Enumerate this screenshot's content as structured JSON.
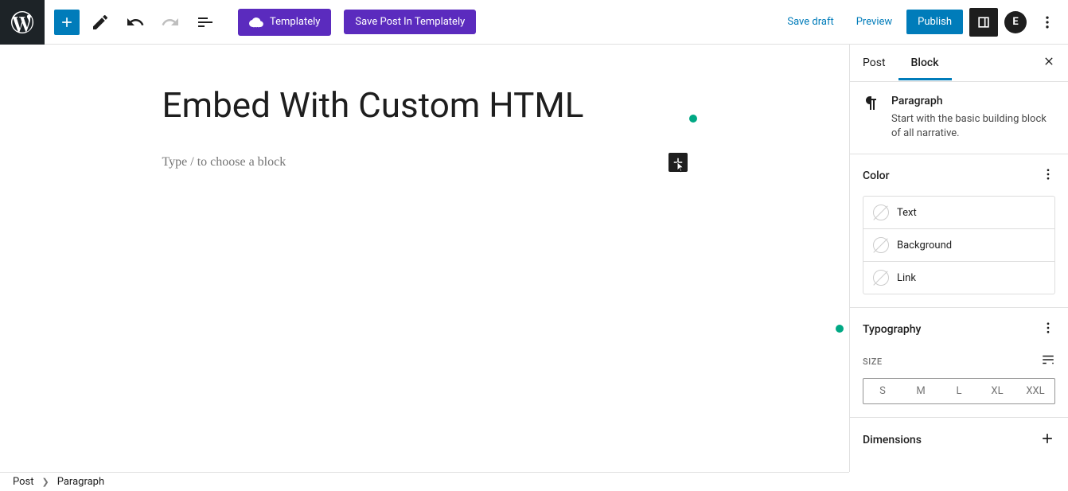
{
  "toolbar": {
    "templately_label": "Templately",
    "save_templately_label": "Save Post In Templately",
    "save_draft_label": "Save draft",
    "preview_label": "Preview",
    "publish_label": "Publish"
  },
  "editor": {
    "title": "Embed With Custom HTML",
    "block_placeholder": "Type / to choose a block"
  },
  "sidebar": {
    "tabs": {
      "post": "Post",
      "block": "Block"
    },
    "block_info": {
      "title": "Paragraph",
      "description": "Start with the basic building block of all narrative."
    },
    "panels": {
      "color": {
        "title": "Color",
        "items": {
          "text": "Text",
          "background": "Background",
          "link": "Link"
        }
      },
      "typography": {
        "title": "Typography",
        "size_label": "SIZE",
        "sizes": [
          "S",
          "M",
          "L",
          "XL",
          "XXL"
        ]
      },
      "dimensions": {
        "title": "Dimensions"
      }
    }
  },
  "breadcrumb": {
    "post": "Post",
    "paragraph": "Paragraph"
  }
}
